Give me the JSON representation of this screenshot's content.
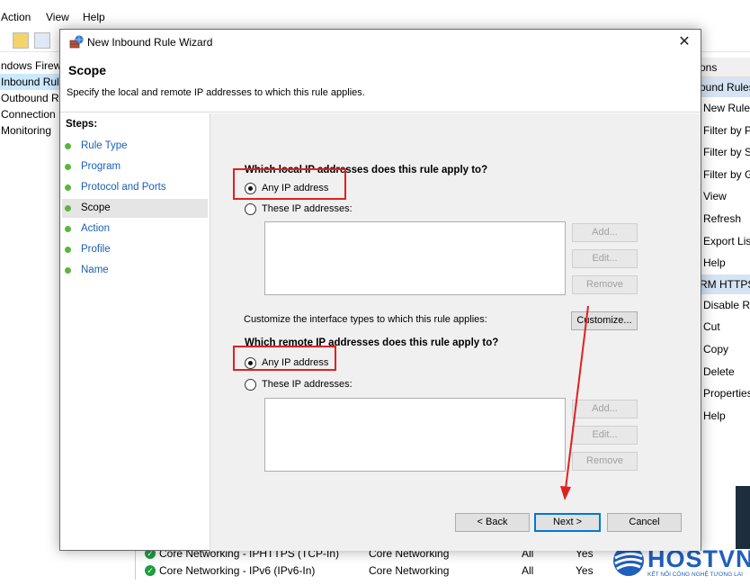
{
  "background": {
    "menu": [
      "Action",
      "View",
      "Help"
    ],
    "tree": [
      "ndows Firewa",
      "Inbound Rul",
      "Outbound R",
      "Connection",
      "Monitoring"
    ],
    "actions_header": "ons",
    "actions_group1": "ound Rules",
    "actions_items1": [
      "New Rule...",
      "Filter by P",
      "Filter by S",
      "Filter by G",
      "View",
      "Refresh",
      "Export List",
      "Help"
    ],
    "actions_group2": "RM HTTPS",
    "actions_items2": [
      "Disable Ru",
      "Cut",
      "Copy",
      "Delete",
      "Properties",
      "Help"
    ],
    "rows": [
      {
        "name": "Core Networking - IPHTTPS (TCP-In)",
        "group": "Core Networking",
        "profile": "All",
        "enabled": "Yes"
      },
      {
        "name": "Core Networking - IPv6 (IPv6-In)",
        "group": "Core Networking",
        "profile": "All",
        "enabled": "Yes"
      }
    ],
    "logo_text": "HOSTVN",
    "logo_sub": "KẾT NỐI CÔNG NGHỆ TƯƠNG LAI"
  },
  "dialog": {
    "title": "New Inbound Rule Wizard",
    "heading": "Scope",
    "description": "Specify the local and remote IP addresses to which this rule applies.",
    "steps_title": "Steps:",
    "steps": [
      "Rule Type",
      "Program",
      "Protocol and Ports",
      "Scope",
      "Action",
      "Profile",
      "Name"
    ],
    "active_step": "Scope",
    "local_question": "Which local IP addresses does this rule apply to?",
    "local_any": "Any IP address",
    "local_these": "These IP addresses:",
    "local_selected": "Any IP address",
    "remote_question": "Which remote IP addresses does this rule apply to?",
    "remote_any": "Any IP address",
    "remote_these": "These IP addresses:",
    "remote_selected": "Any IP address",
    "add_label": "Add...",
    "edit_label": "Edit...",
    "remove_label": "Remove",
    "customize_text": "Customize the interface types to which this rule applies:",
    "customize_label": "Customize...",
    "back_label": "< Back",
    "next_label": "Next >",
    "cancel_label": "Cancel"
  },
  "annotation_color": "#e02020"
}
